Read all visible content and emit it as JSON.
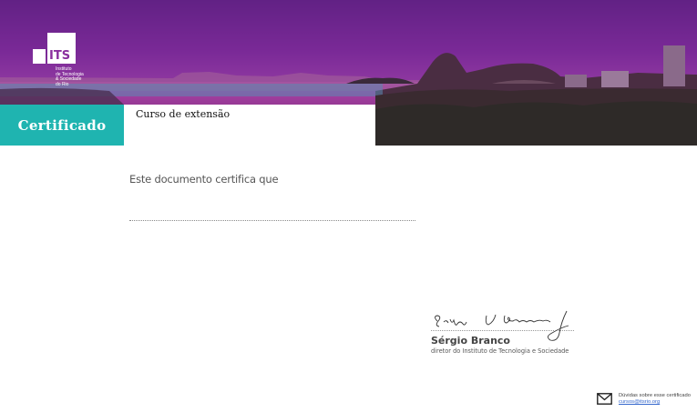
{
  "logo": {
    "mark_text": "ITS",
    "lines": [
      "Instituto",
      "de Tecnologia",
      "& Sociedade",
      "do Rio"
    ]
  },
  "certificate": {
    "label": "Certificado",
    "course_type": "Curso de extensão",
    "intro_text": "Este documento certifica que"
  },
  "signatory": {
    "name": "Sérgio Branco",
    "title": "diretor do Instituto de Tecnologia e Sociedade"
  },
  "contact": {
    "label": "Dúvidas sobre esse certificado",
    "email": "cursos@itsrio.org",
    "icon": "mail-icon"
  },
  "colors": {
    "accent_teal": "#1fb4b0",
    "banner_purple": "#8a2f9e",
    "link_blue": "#3366cc"
  }
}
